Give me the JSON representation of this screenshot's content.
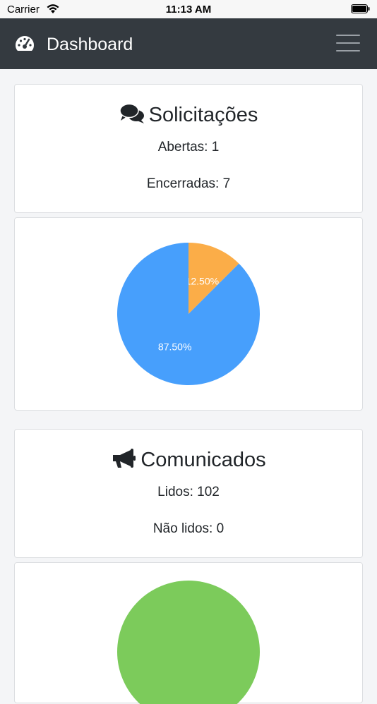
{
  "status_bar": {
    "carrier": "Carrier",
    "time": "11:13 AM"
  },
  "navbar": {
    "title": "Dashboard",
    "icon": "tachometer-icon",
    "menu_icon": "hamburger-icon"
  },
  "solicitacoes": {
    "title": "Solicitações",
    "icon": "comments-icon",
    "open_text": "Abertas: 1",
    "closed_text": "Encerradas: 7"
  },
  "comunicados": {
    "title": "Comunicados",
    "icon": "bullhorn-icon",
    "read_text": "Lidos: 102",
    "unread_text": "Não lidos: 0"
  },
  "chart_data": [
    {
      "type": "pie",
      "values": [
        1,
        7
      ],
      "labels": [
        "12.50%",
        "87.50%"
      ],
      "colors": [
        "#fbad48",
        "#479ffc"
      ]
    },
    {
      "type": "pie",
      "values": [
        102,
        0
      ],
      "labels": [],
      "colors": [
        "#7ccb5b",
        "#e0e0e0"
      ]
    }
  ]
}
